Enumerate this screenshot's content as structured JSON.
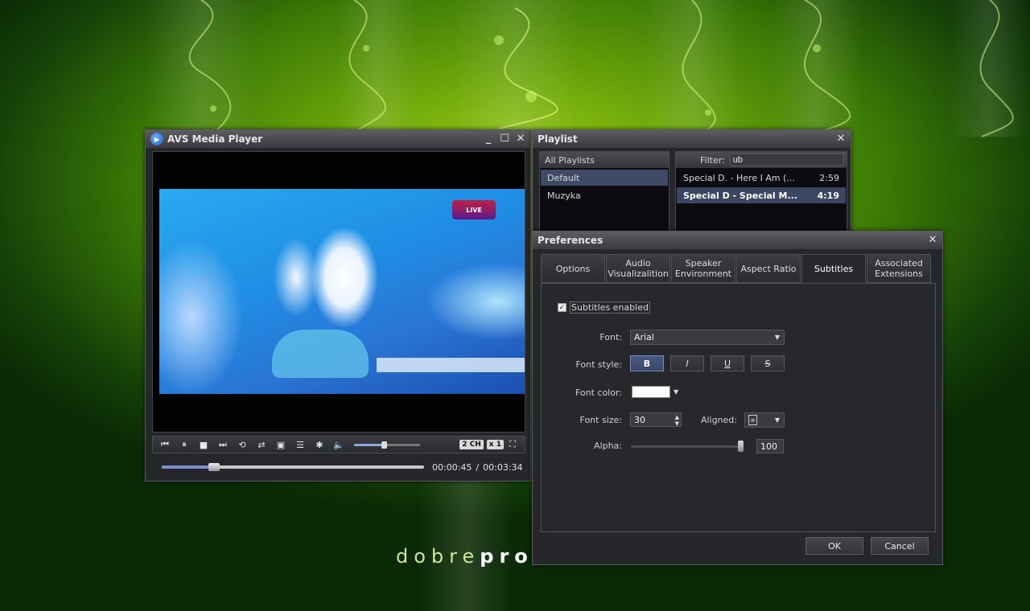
{
  "brand": {
    "prefix": "dobre",
    "suffix": "pro"
  },
  "player": {
    "title": "AVS Media Player",
    "channels_badge": "2 CH",
    "speed_badge": "x 1",
    "volume": 0.45,
    "progress": 0.2,
    "time_current": "00:00:45",
    "time_separator": "/",
    "time_total": "00:03:34",
    "video_logo": "LIVE"
  },
  "playlist": {
    "title": "Playlist",
    "all_playlists_label": "All Playlists",
    "playlists": [
      {
        "name": "Default",
        "selected": true
      },
      {
        "name": "Muzyka",
        "selected": false
      }
    ],
    "filter_label": "Filter:",
    "filter_value": "ub",
    "tracks": [
      {
        "title": "Special D. - Here I Am (...",
        "duration": "2:59",
        "selected": false
      },
      {
        "title": "Special D - Special M...",
        "duration": "4:19",
        "selected": true
      }
    ]
  },
  "prefs": {
    "title": "Preferences",
    "tabs": [
      {
        "label": "Options"
      },
      {
        "label": "Audio Visualizalition"
      },
      {
        "label": "Speaker Environment"
      },
      {
        "label": "Aspect Ratio"
      },
      {
        "label": "Subtitles",
        "active": true
      },
      {
        "label": "Associated Extensions"
      }
    ],
    "subtitles_enabled_label": "Subtitles enabled",
    "subtitles_enabled": true,
    "font_label": "Font:",
    "font_value": "Arial",
    "font_style_label": "Font style:",
    "style_buttons": {
      "bold": "B",
      "italic": "I",
      "underline": "U",
      "strike": "S"
    },
    "font_color_label": "Font color:",
    "font_color": "#ffffff",
    "font_size_label": "Font size:",
    "font_size_value": "30",
    "aligned_label": "Aligned:",
    "alpha_label": "Alpha:",
    "alpha_value": "100",
    "ok_label": "OK",
    "cancel_label": "Cancel"
  },
  "colors": {
    "selection": "#3e4a66",
    "accent": "#7b90cc"
  }
}
